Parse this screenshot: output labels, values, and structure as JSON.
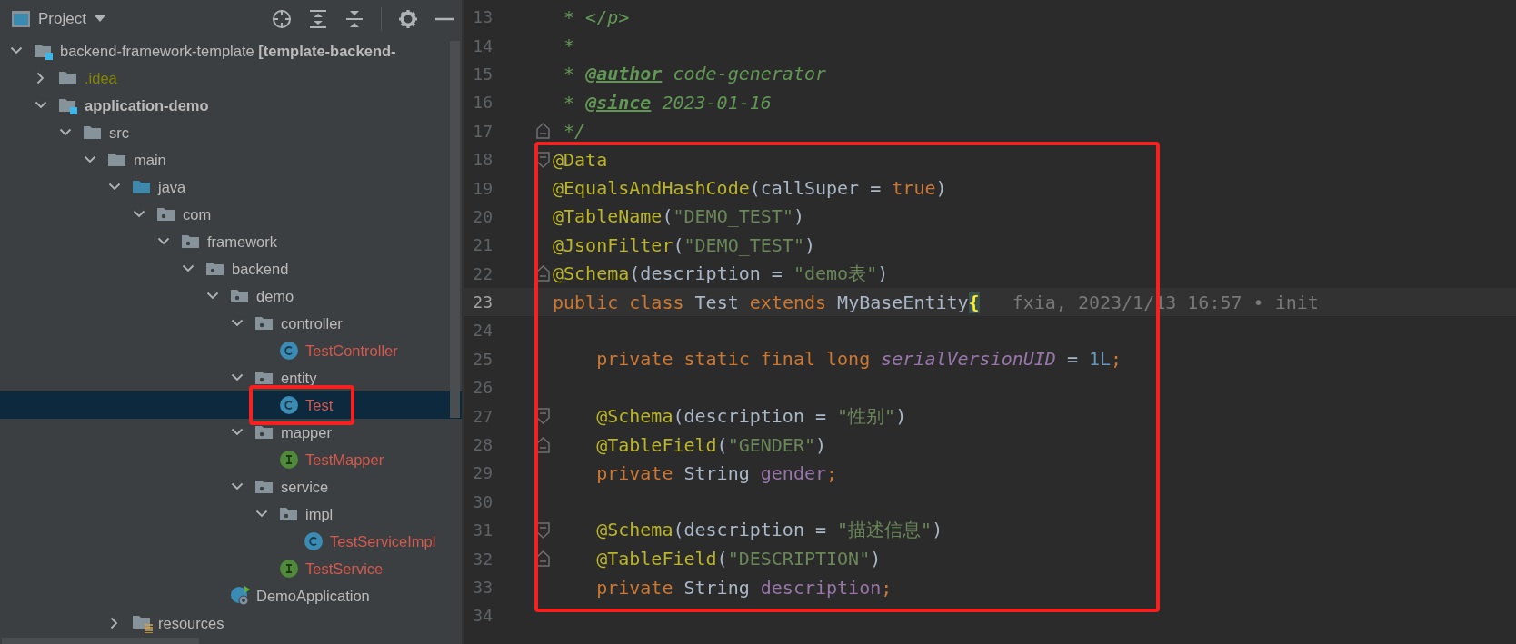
{
  "project_panel": {
    "title": "Project",
    "toolbar": [
      {
        "kind": "locate"
      },
      {
        "kind": "expand-all"
      },
      {
        "kind": "collapse-all"
      },
      {
        "kind": "separator"
      },
      {
        "kind": "settings"
      },
      {
        "kind": "minimize"
      }
    ]
  },
  "tree": {
    "items": [
      {
        "label": "backend-framework-template **[template-backend-**",
        "kind": "module",
        "color": "#bbbbbb",
        "bold": false,
        "expanded": true,
        "selected": false,
        "boxed": false,
        "children": [
          {
            "label": ".idea",
            "kind": "folder",
            "color": "#848504",
            "bold": false,
            "expanded": false,
            "selected": false,
            "boxed": false
          },
          {
            "label": "application-demo",
            "kind": "module",
            "color": "#bbbbbb",
            "bold": true,
            "expanded": true,
            "selected": false,
            "boxed": false,
            "children": [
              {
                "label": "src",
                "kind": "folder",
                "color": "#bbbbbb",
                "bold": false,
                "expanded": true,
                "selected": false,
                "boxed": false,
                "children": [
                  {
                    "label": "main",
                    "kind": "folder",
                    "color": "#bbbbbb",
                    "bold": false,
                    "expanded": true,
                    "selected": false,
                    "boxed": false,
                    "children": [
                      {
                        "label": "java",
                        "kind": "source-folder",
                        "color": "#bbbbbb",
                        "bold": false,
                        "expanded": true,
                        "selected": false,
                        "boxed": false,
                        "children": [
                          {
                            "label": "com",
                            "kind": "package",
                            "color": "#bbbbbb",
                            "bold": false,
                            "expanded": true,
                            "selected": false,
                            "boxed": false,
                            "children": [
                              {
                                "label": "framework",
                                "kind": "package",
                                "color": "#bbbbbb",
                                "bold": false,
                                "expanded": true,
                                "selected": false,
                                "boxed": false,
                                "children": [
                                  {
                                    "label": "backend",
                                    "kind": "package",
                                    "color": "#bbbbbb",
                                    "bold": false,
                                    "expanded": true,
                                    "selected": false,
                                    "boxed": false,
                                    "children": [
                                      {
                                        "label": "demo",
                                        "kind": "package",
                                        "color": "#bbbbbb",
                                        "bold": false,
                                        "expanded": true,
                                        "selected": false,
                                        "boxed": false,
                                        "children": [
                                          {
                                            "label": "controller",
                                            "kind": "package",
                                            "color": "#bbbbbb",
                                            "bold": false,
                                            "expanded": true,
                                            "selected": false,
                                            "boxed": false,
                                            "children": [
                                              {
                                                "label": "TestController",
                                                "kind": "class",
                                                "color": "#d25a4f",
                                                "bold": false,
                                                "selected": false,
                                                "boxed": false
                                              }
                                            ]
                                          },
                                          {
                                            "label": "entity",
                                            "kind": "package",
                                            "color": "#bbbbbb",
                                            "bold": false,
                                            "expanded": true,
                                            "selected": false,
                                            "boxed": false,
                                            "children": [
                                              {
                                                "label": "Test",
                                                "kind": "class",
                                                "color": "#d25a4f",
                                                "bold": false,
                                                "selected": true,
                                                "boxed": true
                                              }
                                            ]
                                          },
                                          {
                                            "label": "mapper",
                                            "kind": "package",
                                            "color": "#bbbbbb",
                                            "bold": false,
                                            "expanded": true,
                                            "selected": false,
                                            "boxed": false,
                                            "children": [
                                              {
                                                "label": "TestMapper",
                                                "kind": "interface",
                                                "color": "#d25a4f",
                                                "bold": false,
                                                "selected": false,
                                                "boxed": false
                                              }
                                            ]
                                          },
                                          {
                                            "label": "service",
                                            "kind": "package",
                                            "color": "#bbbbbb",
                                            "bold": false,
                                            "expanded": true,
                                            "selected": false,
                                            "boxed": false,
                                            "children": [
                                              {
                                                "label": "impl",
                                                "kind": "package",
                                                "color": "#bbbbbb",
                                                "bold": false,
                                                "expanded": true,
                                                "selected": false,
                                                "boxed": false,
                                                "children": [
                                                  {
                                                    "label": "TestServiceImpl",
                                                    "kind": "class",
                                                    "color": "#d25a4f",
                                                    "bold": false,
                                                    "selected": false,
                                                    "boxed": false
                                                  }
                                                ]
                                              },
                                              {
                                                "label": "TestService",
                                                "kind": "interface",
                                                "color": "#d25a4f",
                                                "bold": false,
                                                "selected": false,
                                                "boxed": false
                                              }
                                            ]
                                          }
                                        ]
                                      },
                                      {
                                        "label": "DemoApplication",
                                        "kind": "spring-app",
                                        "color": "#bbbbbb",
                                        "bold": false,
                                        "selected": false,
                                        "boxed": false
                                      }
                                    ]
                                  }
                                ]
                              }
                            ]
                          }
                        ]
                      },
                      {
                        "label": "resources",
                        "kind": "resources-folder",
                        "color": "#bbbbbb",
                        "bold": false,
                        "expanded": false,
                        "selected": false,
                        "boxed": false
                      }
                    ]
                  }
                ]
              }
            ]
          }
        ]
      }
    ]
  },
  "code": {
    "blocks": [
      {
        "boxed": false,
        "lines": [
          {
            "number": "13",
            "current": false,
            "tokens": [
              {
                "kind": "comment",
                "text": " * </p>"
              }
            ]
          },
          {
            "number": "14",
            "current": false,
            "tokens": [
              {
                "kind": "comment",
                "text": " *"
              }
            ]
          },
          {
            "number": "15",
            "current": false,
            "tokens": [
              {
                "kind": "comment",
                "text": " * "
              },
              {
                "kind": "doctag",
                "text": "@author"
              },
              {
                "kind": "comment",
                "text": " code-generator"
              }
            ]
          },
          {
            "number": "16",
            "current": false,
            "tokens": [
              {
                "kind": "comment",
                "text": " * "
              },
              {
                "kind": "doctag",
                "text": "@since"
              },
              {
                "kind": "comment",
                "text": " 2023-01-16"
              }
            ]
          },
          {
            "number": "17",
            "current": false,
            "fold": {
              "kind": "end"
            },
            "tokens": [
              {
                "kind": "comment",
                "text": " */"
              }
            ]
          }
        ]
      },
      {
        "boxed": true,
        "lines": [
          {
            "number": "18",
            "current": false,
            "fold": {
              "kind": "start"
            },
            "tokens": [
              {
                "kind": "annotation",
                "text": "@Data"
              }
            ]
          },
          {
            "number": "19",
            "current": false,
            "tokens": [
              {
                "kind": "annotation",
                "text": "@EqualsAndHashCode"
              },
              {
                "kind": "plain",
                "text": "(callSuper = "
              },
              {
                "kind": "keyword",
                "text": "true"
              },
              {
                "kind": "plain",
                "text": ")"
              }
            ]
          },
          {
            "number": "20",
            "current": false,
            "tokens": [
              {
                "kind": "annotation",
                "text": "@TableName"
              },
              {
                "kind": "plain",
                "text": "("
              },
              {
                "kind": "string",
                "text": "\"DEMO_TEST\""
              },
              {
                "kind": "plain",
                "text": ")"
              }
            ]
          },
          {
            "number": "21",
            "current": false,
            "tokens": [
              {
                "kind": "annotation",
                "text": "@JsonFilter"
              },
              {
                "kind": "plain",
                "text": "("
              },
              {
                "kind": "string",
                "text": "\"DEMO_TEST\""
              },
              {
                "kind": "plain",
                "text": ")"
              }
            ]
          },
          {
            "number": "22",
            "current": false,
            "fold": {
              "kind": "end"
            },
            "tokens": [
              {
                "kind": "annotation",
                "text": "@Schema"
              },
              {
                "kind": "plain",
                "text": "(description = "
              },
              {
                "kind": "string",
                "text": "\"demo表\""
              },
              {
                "kind": "plain",
                "text": ")"
              }
            ]
          },
          {
            "number": "23",
            "current": true,
            "inlay": "fxia, 2023/1/13 16:57 • init",
            "tokens": [
              {
                "kind": "keyword",
                "text": "public class "
              },
              {
                "kind": "plain",
                "text": "Test "
              },
              {
                "kind": "keyword",
                "text": "extends "
              },
              {
                "kind": "plain",
                "text": "MyBaseEntity"
              },
              {
                "kind": "brace-match",
                "text": "{"
              }
            ]
          },
          {
            "number": "24",
            "current": false
          },
          {
            "number": "25",
            "current": false,
            "indented": true,
            "tokens": [
              {
                "kind": "keyword",
                "text": "private static final long "
              },
              {
                "kind": "static-field",
                "text": "serialVersionUID"
              },
              {
                "kind": "plain",
                "text": " = "
              },
              {
                "kind": "number",
                "text": "1L"
              },
              {
                "kind": "keyword",
                "text": ";"
              }
            ]
          },
          {
            "number": "26",
            "current": false
          },
          {
            "number": "27",
            "current": false,
            "indented": true,
            "fold": {
              "kind": "start"
            },
            "tokens": [
              {
                "kind": "annotation",
                "text": "@Schema"
              },
              {
                "kind": "plain",
                "text": "(description = "
              },
              {
                "kind": "string",
                "text": "\"性别\""
              },
              {
                "kind": "plain",
                "text": ")"
              }
            ]
          },
          {
            "number": "28",
            "current": false,
            "indented": true,
            "fold": {
              "kind": "end"
            },
            "tokens": [
              {
                "kind": "annotation",
                "text": "@TableField"
              },
              {
                "kind": "plain",
                "text": "("
              },
              {
                "kind": "string",
                "text": "\"GENDER\""
              },
              {
                "kind": "plain",
                "text": ")"
              }
            ]
          },
          {
            "number": "29",
            "current": false,
            "indented": true,
            "tokens": [
              {
                "kind": "keyword",
                "text": "private "
              },
              {
                "kind": "plain",
                "text": "String "
              },
              {
                "kind": "field",
                "text": "gender"
              },
              {
                "kind": "keyword",
                "text": ";"
              }
            ]
          },
          {
            "number": "30",
            "current": false
          },
          {
            "number": "31",
            "current": false,
            "indented": true,
            "fold": {
              "kind": "start"
            },
            "tokens": [
              {
                "kind": "annotation",
                "text": "@Schema"
              },
              {
                "kind": "plain",
                "text": "(description = "
              },
              {
                "kind": "string",
                "text": "\"描述信息\""
              },
              {
                "kind": "plain",
                "text": ")"
              }
            ]
          },
          {
            "number": "32",
            "current": false,
            "indented": true,
            "fold": {
              "kind": "end"
            },
            "tokens": [
              {
                "kind": "annotation",
                "text": "@TableField"
              },
              {
                "kind": "plain",
                "text": "("
              },
              {
                "kind": "string",
                "text": "\"DESCRIPTION\""
              },
              {
                "kind": "plain",
                "text": ")"
              }
            ]
          },
          {
            "number": "33",
            "current": false,
            "indented": true,
            "tokens": [
              {
                "kind": "keyword",
                "text": "private "
              },
              {
                "kind": "plain",
                "text": "String "
              },
              {
                "kind": "field",
                "text": "description"
              },
              {
                "kind": "keyword",
                "text": ";"
              }
            ]
          }
        ]
      },
      {
        "boxed": false,
        "lines": [
          {
            "number": "34",
            "current": false
          }
        ]
      }
    ]
  }
}
